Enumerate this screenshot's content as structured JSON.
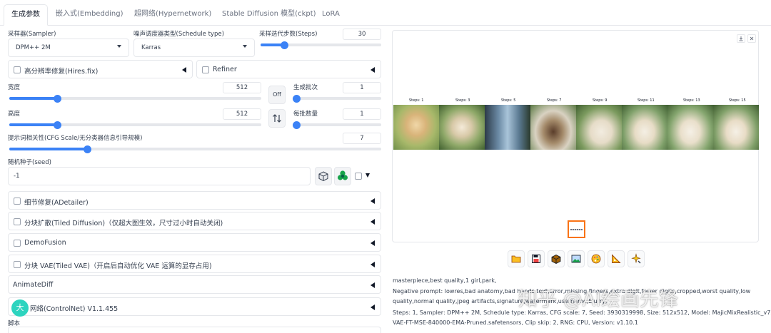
{
  "tabs": [
    "生成参数",
    "嵌入式(Embedding)",
    "超网络(Hypernetwork)",
    "Stable Diffusion 模型(ckpt)",
    "LoRA"
  ],
  "sampler": {
    "label": "采样器(Sampler)",
    "value": "DPM++ 2M"
  },
  "schedule": {
    "label": "噪声调度器类型(Schedule type)",
    "value": "Karras"
  },
  "steps": {
    "label": "采样迭代步数(Steps)",
    "value": "30",
    "level": 0.2
  },
  "hires": {
    "label": "高分辨率修复(Hires.fix)"
  },
  "refiner": {
    "label": "Refiner"
  },
  "width": {
    "label": "宽度",
    "value": "512",
    "level": 0.19
  },
  "height": {
    "label": "高度",
    "value": "512",
    "level": 0.19
  },
  "off_label": "Off",
  "batch_count": {
    "label": "生成批次",
    "value": "1",
    "level": 0.03
  },
  "batch_size": {
    "label": "每批数量",
    "value": "1",
    "level": 0.03
  },
  "cfg": {
    "label": "提示词相关性(CFG Scale/无分类器信息引导规模)",
    "value": "7",
    "level": 0.21
  },
  "seed": {
    "label": "随机种子(seed)",
    "value": "-1"
  },
  "accordions": [
    "细节修复(ADetailer)",
    "分块扩散(Tiled Diffusion)（仅超大图生效，尺寸过小时自动关闭)",
    "DemoFusion",
    "分块 VAE(Tiled VAE)（开启后自动优化 VAE 运算的显存占用)",
    "AnimateDiff",
    "网络(ControlNet) V1.1.455"
  ],
  "avatar_char": "大",
  "script_label": "脚本",
  "grid": {
    "labels": [
      "Steps: 1",
      "Steps: 3",
      "Steps: 5",
      "Steps: 7",
      "Steps: 9",
      "Steps: 11",
      "Steps: 13",
      "Steps: 15"
    ]
  },
  "info": {
    "line1": "masterpiece,best quality,1 girl,park,",
    "line2": "Negative prompt: lowres,bad anatomy,bad hands,text,error,missing fingers,extra digit,fewer digits,cropped,worst quality,low",
    "line3": "quality,normal quality,jpeg artifacts,signature,watermark,username,blurry,",
    "line4": "Steps: 1, Sampler: DPM++ 2M, Schedule type: Karras, CFG scale: 7, Seed: 3930319998, Size: 512x512, Model: MajicMixRealistic_v7, VAE:",
    "line5": "VAE-FT-MSE-840000-EMA-Pruned.safetensors, Clip skip: 2, RNG: CPU, Version: v1.10.1"
  },
  "watermark": "知乎 @AI绘画先锋",
  "colors": {
    "accent": "#3b82f6",
    "highlight_box": "#f97316"
  }
}
